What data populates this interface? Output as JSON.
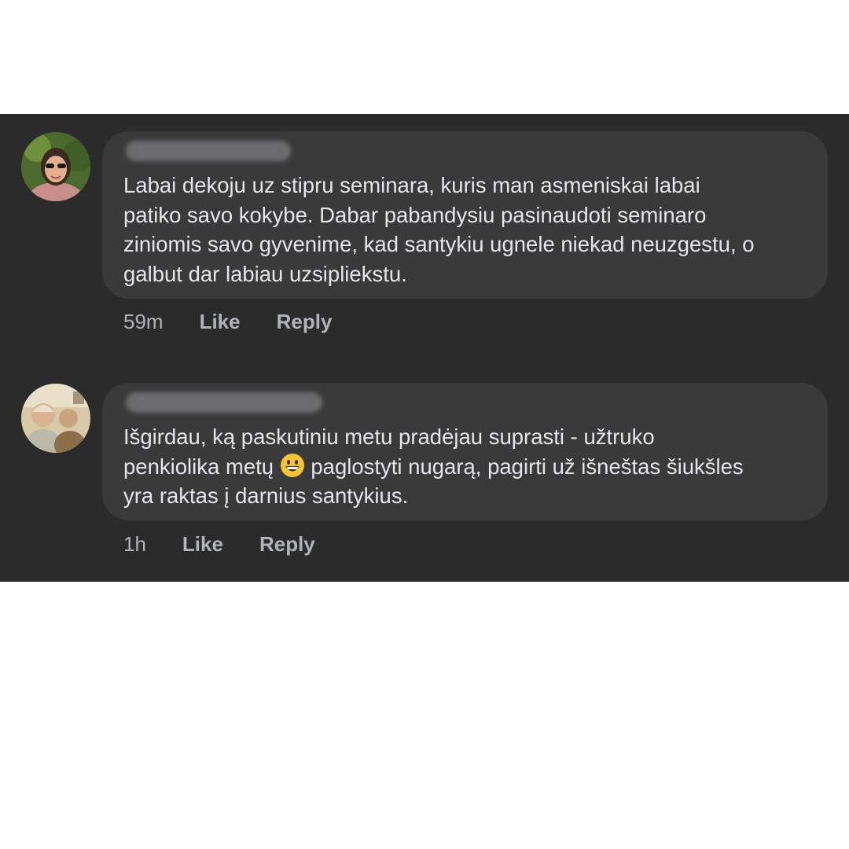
{
  "comments": [
    {
      "text": "Labai dekoju uz stipru seminara, kuris man asmeniskai labai\npatiko savo kokybe. Dabar pabandysiu pasinaudoti seminaro\nziniomis savo gyvenime, kad santykiu ugnele niekad neuzgestu, o\ngalbut dar labiau uzsipliekstu.",
      "time": "59m",
      "like_label": "Like",
      "reply_label": "Reply"
    },
    {
      "text_before_emoji": "Išgirdau, ką paskutiniu metu pradėjau suprasti - užtruko\npenkiolika metų ",
      "emoji": "grinning-face-emoji",
      "text_after_emoji": " paglostyti nugarą, pagirti už išneštas šiukšles\nyra raktas į darnius santykius.",
      "time": "1h",
      "like_label": "Like",
      "reply_label": "Reply"
    }
  ],
  "colors": {
    "panel_bg": "#2b2b2b",
    "bubble_bg": "#3a3a3b",
    "text": "#e4e6eb",
    "meta": "#b0b3b8"
  }
}
